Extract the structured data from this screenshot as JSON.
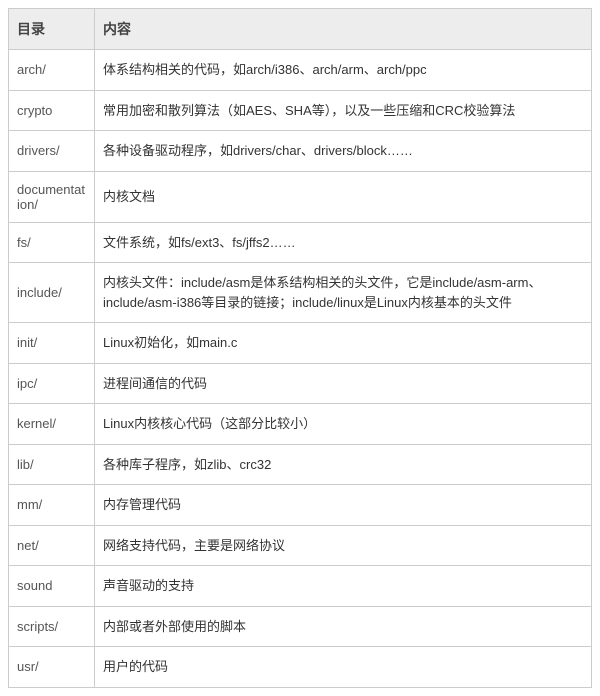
{
  "headers": {
    "dir": "目录",
    "content": "内容"
  },
  "rows": [
    {
      "dir": "arch/",
      "content": "体系结构相关的代码，如arch/i386、arch/arm、arch/ppc"
    },
    {
      "dir": "crypto",
      "content": "常用加密和散列算法（如AES、SHA等），以及一些压缩和CRC校验算法"
    },
    {
      "dir": "drivers/",
      "content": "各种设备驱动程序，如drivers/char、drivers/block……"
    },
    {
      "dir": "documentation/",
      "content": "内核文档"
    },
    {
      "dir": "fs/",
      "content": "文件系统，如fs/ext3、fs/jffs2……"
    },
    {
      "dir": "include/",
      "content": "内核头文件：include/asm是体系结构相关的头文件，它是include/asm-arm、include/asm-i386等目录的链接；include/linux是Linux内核基本的头文件"
    },
    {
      "dir": "init/",
      "content": "Linux初始化，如main.c"
    },
    {
      "dir": "ipc/",
      "content": "进程间通信的代码"
    },
    {
      "dir": "kernel/",
      "content": "Linux内核核心代码（这部分比较小）"
    },
    {
      "dir": "lib/",
      "content": "各种库子程序，如zlib、crc32"
    },
    {
      "dir": "mm/",
      "content": "内存管理代码"
    },
    {
      "dir": "net/",
      "content": "网络支持代码，主要是网络协议"
    },
    {
      "dir": "sound",
      "content": "声音驱动的支持"
    },
    {
      "dir": "scripts/",
      "content": "内部或者外部使用的脚本"
    },
    {
      "dir": "usr/",
      "content": "用户的代码"
    }
  ]
}
